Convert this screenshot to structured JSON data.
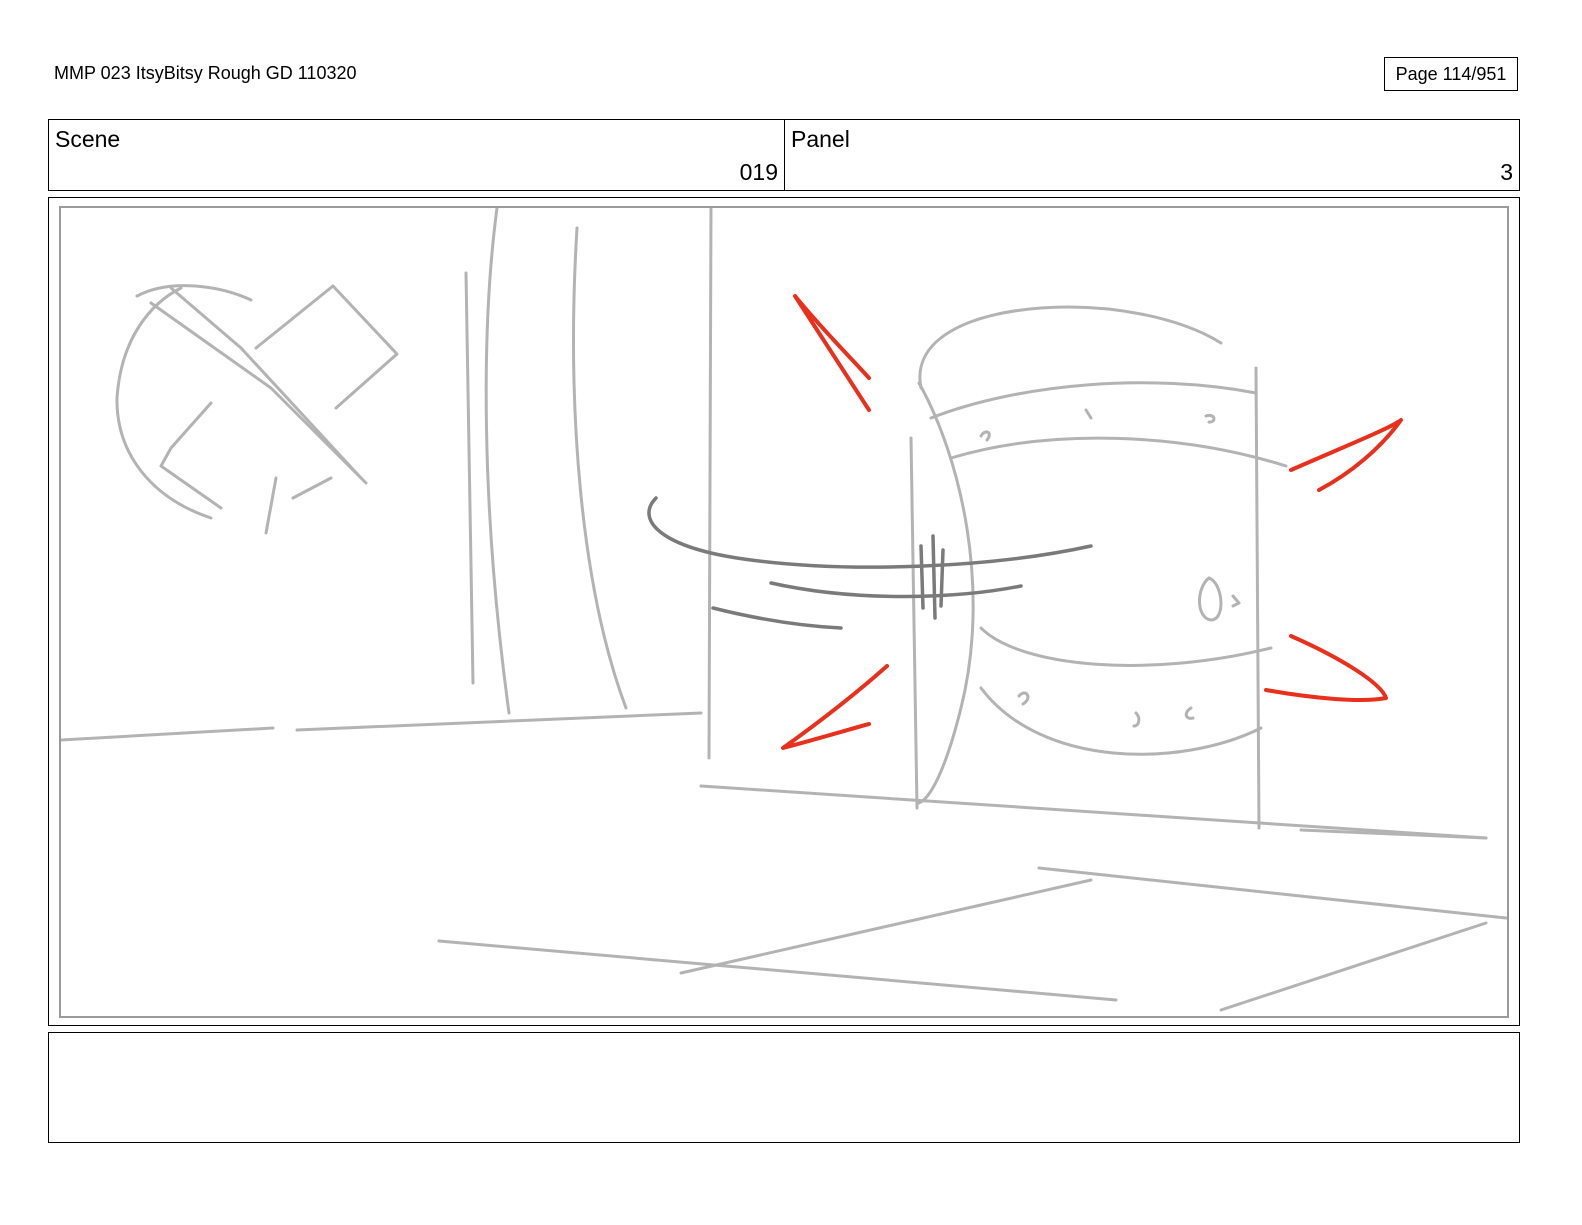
{
  "header": {
    "document_title": "MMP 023 ItsyBitsy Rough GD 110320",
    "page_label": "Page 114/951"
  },
  "info_row": {
    "scene_label": "Scene",
    "scene_value": "019",
    "panel_label": "Panel",
    "panel_value": "3"
  },
  "sketch": {
    "description_hidden": false,
    "line_color": "#b3b3b3",
    "dark_line_color": "#7a7a7a",
    "impact_color": "#e8301c",
    "notes": ""
  }
}
